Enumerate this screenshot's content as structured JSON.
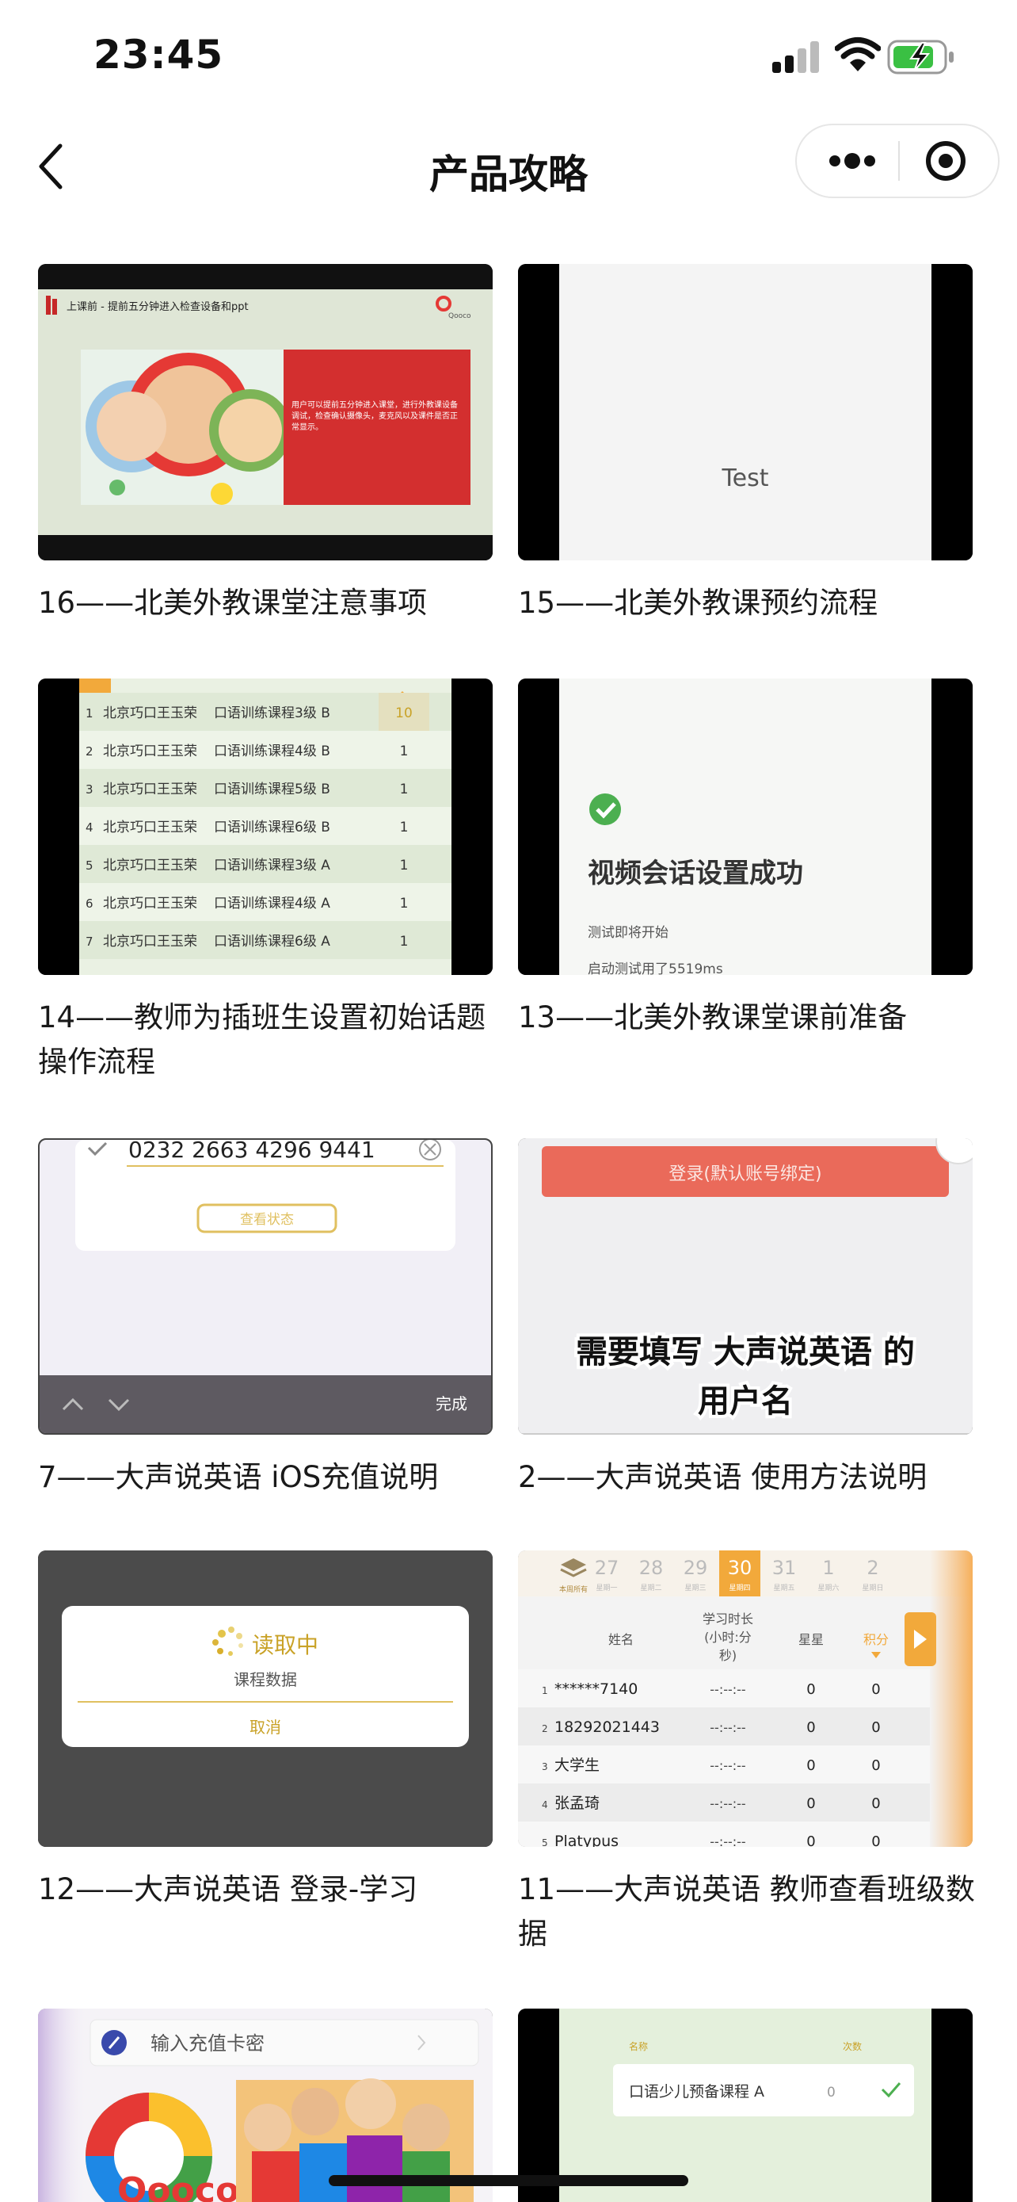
{
  "status_bar": {
    "time": "23:45"
  },
  "nav": {
    "title": "产品攻略"
  },
  "cards": [
    {
      "caption": "16——北美外教课堂注意事项",
      "thumb": {
        "header": "上课前 - 提前五分钟进入检查设备和ppt",
        "logo": "Qooco",
        "body": "用户可以提前五分钟进入课堂，进行外教课设备调试，检查确认摄像头，麦克风以及课件是否正常显示。"
      }
    },
    {
      "caption": "15——北美外教课预约流程",
      "thumb": {
        "text": "Test"
      }
    },
    {
      "caption": "14——教师为插班生设置初始话题操作流程",
      "thumb": {
        "rows": [
          {
            "n": "1",
            "school": "北京巧口王玉荣",
            "course": "口语训练课程3级 B",
            "val": "10"
          },
          {
            "n": "2",
            "school": "北京巧口王玉荣",
            "course": "口语训练课程4级 B",
            "val": "1"
          },
          {
            "n": "3",
            "school": "北京巧口王玉荣",
            "course": "口语训练课程5级 B",
            "val": "1"
          },
          {
            "n": "4",
            "school": "北京巧口王玉荣",
            "course": "口语训练课程6级 B",
            "val": "1"
          },
          {
            "n": "5",
            "school": "北京巧口王玉荣",
            "course": "口语训练课程3级 A",
            "val": "1"
          },
          {
            "n": "6",
            "school": "北京巧口王玉荣",
            "course": "口语训练课程4级 A",
            "val": "1"
          },
          {
            "n": "7",
            "school": "北京巧口王玉荣",
            "course": "口语训练课程6级 A",
            "val": "1"
          }
        ]
      }
    },
    {
      "caption": "13——北美外教课堂课前准备",
      "thumb": {
        "title": "视频会话设置成功",
        "line1": "测试即将开始",
        "line2": "启动测试用了5519ms"
      }
    },
    {
      "caption": "7——大声说英语 iOS充值说明",
      "thumb": {
        "code": "0232 2663 4296 9441",
        "button": "查看状态",
        "done": "完成"
      }
    },
    {
      "caption": "2——大声说英语 使用方法说明",
      "thumb": {
        "login": "登录(默认账号绑定)",
        "line1": "需要填写 大声说英语 的",
        "line2": "用户名"
      }
    },
    {
      "caption": "12——大声说英语 登录-学习",
      "thumb": {
        "loading": "读取中",
        "sub": "课程数据",
        "cancel": "取消"
      }
    },
    {
      "caption": "11——大声说英语 教师查看班级数据",
      "thumb": {
        "days": [
          {
            "d": "27",
            "w": "星期一"
          },
          {
            "d": "28",
            "w": "星期二"
          },
          {
            "d": "29",
            "w": "星期三"
          },
          {
            "d": "30",
            "w": "星期四"
          },
          {
            "d": "31",
            "w": "星期五"
          },
          {
            "d": "1",
            "w": "星期六"
          },
          {
            "d": "2",
            "w": "星期日"
          }
        ],
        "today_label": "本周所有",
        "headers": [
          "姓名",
          "学习时长",
          "(小时:分",
          "秒)",
          "星星",
          "积分"
        ],
        "rows": [
          {
            "n": "1",
            "name": "******7140",
            "time": "--:--:--",
            "stars": "0",
            "points": "0"
          },
          {
            "n": "2",
            "name": "18292021443",
            "time": "--:--:--",
            "stars": "0",
            "points": "0"
          },
          {
            "n": "3",
            "name": "大学生",
            "time": "--:--:--",
            "stars": "0",
            "points": "0"
          },
          {
            "n": "4",
            "name": "张孟琦",
            "time": "--:--:--",
            "stars": "0",
            "points": "0"
          },
          {
            "n": "5",
            "name": "Platypus",
            "time": "--:--:--",
            "stars": "0",
            "points": "0"
          }
        ]
      }
    },
    {
      "caption": "",
      "thumb": {
        "input": "输入充值卡密",
        "logo": "Qooco"
      }
    },
    {
      "caption": "",
      "thumb": {
        "col1": "名称",
        "col2": "次数",
        "item": "口语少儿预备课程 A",
        "val": "0"
      }
    }
  ]
}
